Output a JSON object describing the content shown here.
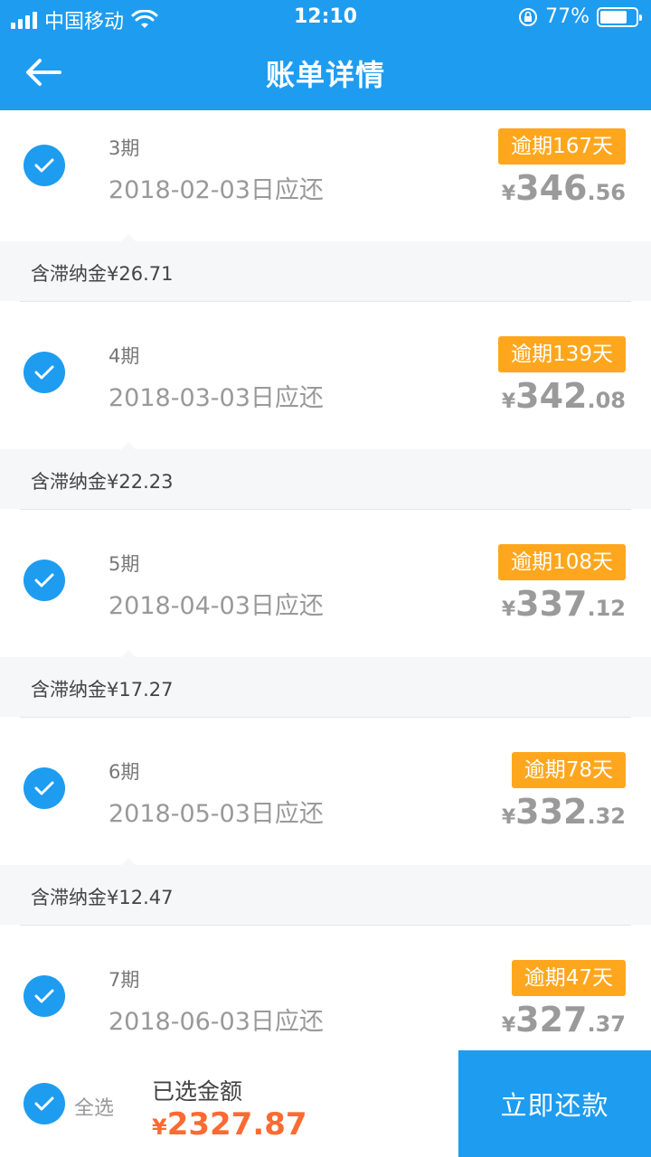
{
  "status_bar": {
    "carrier": "中国移动",
    "time": "12:10",
    "battery": "77%",
    "battery_level": 0.77
  },
  "nav": {
    "title": "账单详情"
  },
  "items": [
    {
      "period": "3期",
      "due": "2018-02-03日应还",
      "overdue": "逾期167天",
      "currency": "¥",
      "amount_int": "346",
      "amount_dec": ".56",
      "late_fee": "含滞纳金¥26.71"
    },
    {
      "period": "4期",
      "due": "2018-03-03日应还",
      "overdue": "逾期139天",
      "currency": "¥",
      "amount_int": "342",
      "amount_dec": ".08",
      "late_fee": "含滞纳金¥22.23"
    },
    {
      "period": "5期",
      "due": "2018-04-03日应还",
      "overdue": "逾期108天",
      "currency": "¥",
      "amount_int": "337",
      "amount_dec": ".12",
      "late_fee": "含滞纳金¥17.27"
    },
    {
      "period": "6期",
      "due": "2018-05-03日应还",
      "overdue": "逾期78天",
      "currency": "¥",
      "amount_int": "332",
      "amount_dec": ".32",
      "late_fee": "含滞纳金¥12.47"
    },
    {
      "period": "7期",
      "due": "2018-06-03日应还",
      "overdue": "逾期47天",
      "currency": "¥",
      "amount_int": "327",
      "amount_dec": ".37"
    }
  ],
  "bottom": {
    "select_all": "全选",
    "selected_label": "已选金额",
    "currency": "¥",
    "selected_amount": "2327.87",
    "pay_button": "立即还款"
  },
  "colors": {
    "primary": "#1e9cf0",
    "badge": "#fea71e",
    "total": "#fd6a33"
  }
}
